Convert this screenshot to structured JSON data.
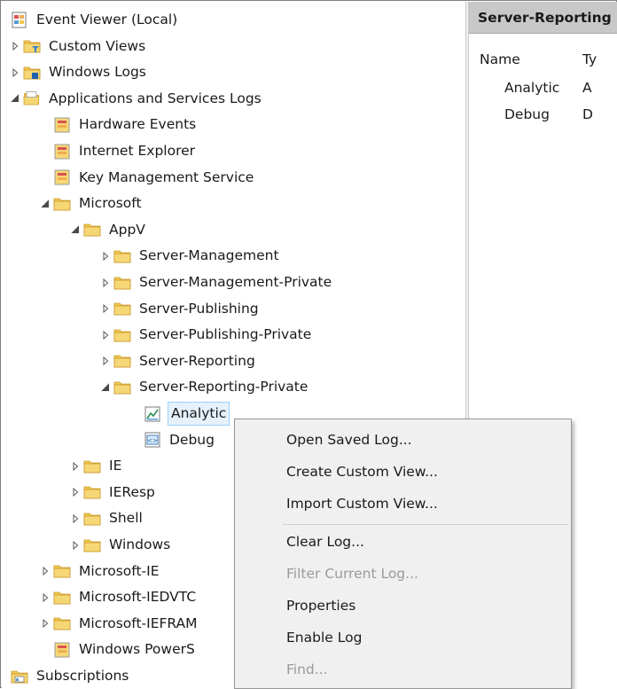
{
  "tree": [
    {
      "id": "root",
      "label": "Event Viewer (Local)",
      "expander": "none",
      "icon": "event-viewer-icon",
      "depth": 0
    },
    {
      "id": "custom-views",
      "label": "Custom Views",
      "expander": "collapsed",
      "icon": "custom-views-folder-icon",
      "depth": 0
    },
    {
      "id": "windows-logs",
      "label": "Windows Logs",
      "expander": "collapsed",
      "icon": "windows-logs-folder-icon",
      "depth": 0
    },
    {
      "id": "apps-services-logs",
      "label": "Applications and Services Logs",
      "expander": "expanded",
      "icon": "open-folder-icon",
      "depth": 0
    },
    {
      "id": "hardware-events",
      "label": "Hardware Events",
      "expander": "none",
      "icon": "log-icon",
      "depth": 1
    },
    {
      "id": "internet-explorer",
      "label": "Internet Explorer",
      "expander": "none",
      "icon": "log-icon",
      "depth": 1
    },
    {
      "id": "key-management-service",
      "label": "Key Management Service",
      "expander": "none",
      "icon": "log-icon",
      "depth": 1
    },
    {
      "id": "microsoft",
      "label": "Microsoft",
      "expander": "expanded",
      "icon": "folder-icon",
      "depth": 1
    },
    {
      "id": "appv",
      "label": "AppV",
      "expander": "expanded",
      "icon": "folder-icon",
      "depth": 2
    },
    {
      "id": "server-management",
      "label": "Server-Management",
      "expander": "collapsed",
      "icon": "folder-icon",
      "depth": 3
    },
    {
      "id": "server-management-private",
      "label": "Server-Management-Private",
      "expander": "collapsed",
      "icon": "folder-icon",
      "depth": 3
    },
    {
      "id": "server-publishing",
      "label": "Server-Publishing",
      "expander": "collapsed",
      "icon": "folder-icon",
      "depth": 3
    },
    {
      "id": "server-publishing-private",
      "label": "Server-Publishing-Private",
      "expander": "collapsed",
      "icon": "folder-icon",
      "depth": 3
    },
    {
      "id": "server-reporting",
      "label": "Server-Reporting",
      "expander": "collapsed",
      "icon": "folder-icon",
      "depth": 3
    },
    {
      "id": "server-reporting-private",
      "label": "Server-Reporting-Private",
      "expander": "expanded",
      "icon": "folder-icon",
      "depth": 3
    },
    {
      "id": "analytic",
      "label": "Analytic",
      "expander": "none",
      "icon": "analytic-log-icon",
      "depth": 4,
      "selected": true
    },
    {
      "id": "debug",
      "label": "Debug",
      "expander": "none",
      "icon": "debug-log-icon",
      "depth": 4
    },
    {
      "id": "ie",
      "label": "IE",
      "expander": "collapsed",
      "icon": "folder-icon",
      "depth": 2
    },
    {
      "id": "ieresp",
      "label": "IEResp",
      "expander": "collapsed",
      "icon": "folder-icon",
      "depth": 2
    },
    {
      "id": "shell",
      "label": "Shell",
      "expander": "collapsed",
      "icon": "folder-icon",
      "depth": 2
    },
    {
      "id": "windows",
      "label": "Windows",
      "expander": "collapsed",
      "icon": "folder-icon",
      "depth": 2
    },
    {
      "id": "microsoft-ie",
      "label": "Microsoft-IE",
      "expander": "collapsed",
      "icon": "folder-icon",
      "depth": 1
    },
    {
      "id": "microsoft-iedvtc",
      "label": "Microsoft-IEDVTC",
      "expander": "collapsed",
      "icon": "folder-icon",
      "depth": 1
    },
    {
      "id": "microsoft-ieframe",
      "label": "Microsoft-IEFRAM",
      "expander": "collapsed",
      "icon": "folder-icon",
      "depth": 1
    },
    {
      "id": "windows-powershell",
      "label": "Windows PowerS",
      "expander": "none",
      "icon": "log-icon",
      "depth": 1
    },
    {
      "id": "subscriptions",
      "label": "Subscriptions",
      "expander": "none",
      "icon": "subscriptions-icon",
      "depth": 0
    }
  ],
  "details": {
    "title": "Server-Reporting",
    "columns": [
      "Name",
      "Ty"
    ],
    "rows": [
      [
        "Analytic",
        "A"
      ],
      [
        "Debug",
        "D"
      ]
    ]
  },
  "context_menu": {
    "items": [
      {
        "id": "open-saved-log",
        "label": "Open Saved Log...",
        "enabled": true
      },
      {
        "id": "create-custom-view",
        "label": "Create Custom View...",
        "enabled": true
      },
      {
        "id": "import-custom-view",
        "label": "Import Custom View...",
        "enabled": true
      },
      {
        "id": "separator",
        "label": "",
        "enabled": false,
        "separator": true
      },
      {
        "id": "clear-log",
        "label": "Clear Log...",
        "enabled": true
      },
      {
        "id": "filter-current-log",
        "label": "Filter Current Log...",
        "enabled": false
      },
      {
        "id": "properties",
        "label": "Properties",
        "enabled": true
      },
      {
        "id": "enable-log",
        "label": "Enable Log",
        "enabled": true
      },
      {
        "id": "find",
        "label": "Find...",
        "enabled": false
      }
    ]
  },
  "colors": {
    "selection_fill": "#e5f1fb",
    "selection_border": "#99d1ff",
    "folder": "#f2c94c",
    "disabled_text": "#9a9a9a",
    "header_bar": "#c8c8c8"
  }
}
